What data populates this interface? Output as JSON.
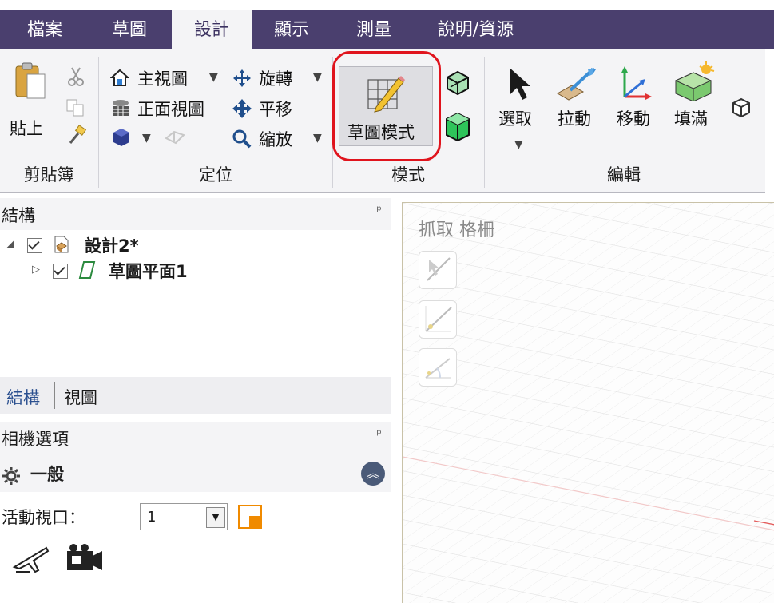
{
  "menu": {
    "tabs": [
      {
        "label": "檔案"
      },
      {
        "label": "草圖"
      },
      {
        "label": "設計"
      },
      {
        "label": "顯示"
      },
      {
        "label": "測量"
      },
      {
        "label": "說明/資源"
      }
    ],
    "active_tab": "設計"
  },
  "ribbon": {
    "clipboard": {
      "paste_label": "貼上",
      "group_label": "剪貼簿"
    },
    "orient": {
      "home_view": "主視圖",
      "front_view": "正面視圖",
      "rotate": "旋轉",
      "pan": "平移",
      "zoom": "縮放",
      "group_label": "定位"
    },
    "mode": {
      "sketch_mode": "草圖模式",
      "group_label": "模式"
    },
    "edit": {
      "select": "選取",
      "pull": "拉動",
      "move": "移動",
      "fill": "填滿",
      "group_label": "編輯"
    }
  },
  "structure": {
    "title": "結構",
    "tree": [
      {
        "label": "設計2*"
      },
      {
        "label": "草圖平面1"
      }
    ],
    "tabs": [
      {
        "label": "結構"
      },
      {
        "label": "視圖"
      }
    ]
  },
  "camera": {
    "title": "相機選項",
    "section": "一般",
    "active_viewport_label": "活動視口：",
    "active_viewport_value": "1"
  },
  "viewport": {
    "snap_label": "抓取 格柵"
  },
  "colors": {
    "menubar": "#4a3f6e",
    "highlight": "#e0141d",
    "ribbon_bg": "#f4f4f6"
  }
}
